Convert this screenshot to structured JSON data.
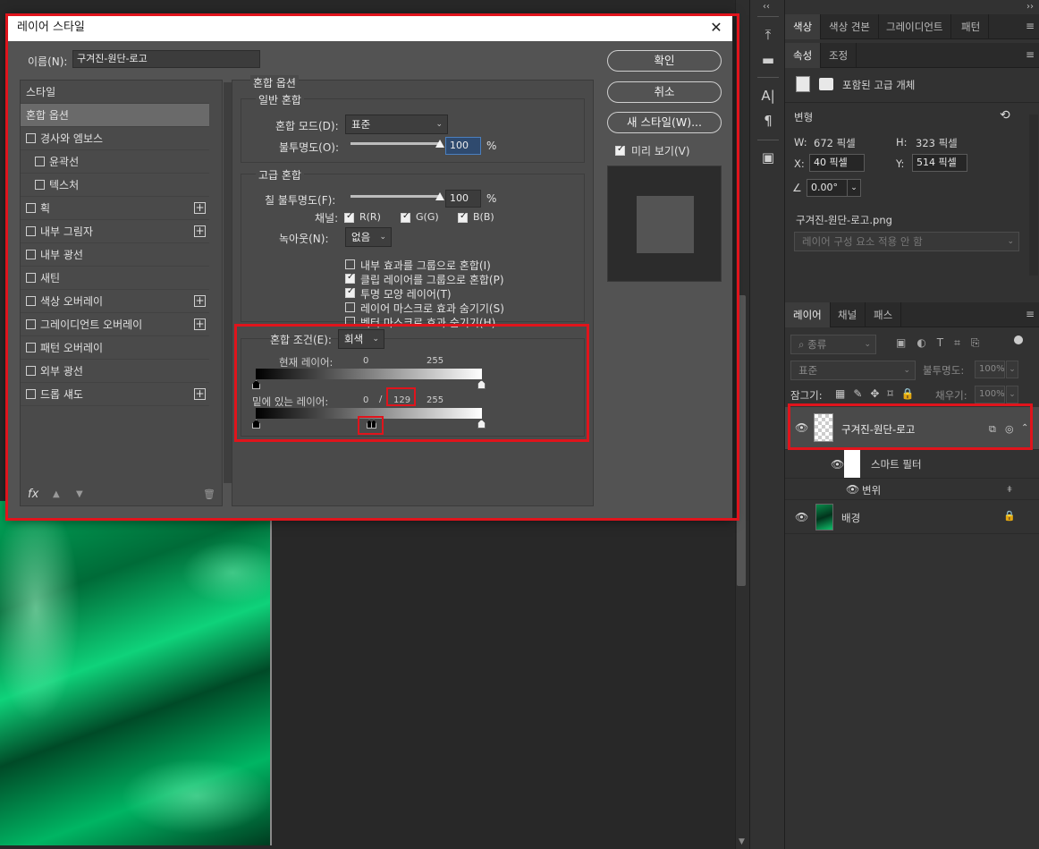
{
  "dialog": {
    "title": "레이어 스타일",
    "close_icon": "✕",
    "name_label": "이름(N):",
    "name_value": "구겨진-원단-로고",
    "buttons": {
      "ok": "확인",
      "cancel": "취소",
      "new_style": "새 스타일(W)...",
      "preview": "미리 보기(V)"
    },
    "styles": [
      {
        "label": "스타일",
        "checkbox": false,
        "plus": false,
        "active": false
      },
      {
        "label": "혼합 옵션",
        "checkbox": false,
        "plus": false,
        "active": true
      },
      {
        "label": "경사와 엠보스",
        "checkbox": true,
        "plus": false
      },
      {
        "label": "윤곽선",
        "checkbox": true,
        "plus": false,
        "indent": true
      },
      {
        "label": "텍스처",
        "checkbox": true,
        "plus": false,
        "indent": true
      },
      {
        "label": "획",
        "checkbox": true,
        "plus": true
      },
      {
        "label": "내부 그림자",
        "checkbox": true,
        "plus": true
      },
      {
        "label": "내부 광선",
        "checkbox": true,
        "plus": false
      },
      {
        "label": "새틴",
        "checkbox": true,
        "plus": false
      },
      {
        "label": "색상 오버레이",
        "checkbox": true,
        "plus": true
      },
      {
        "label": "그레이디언트 오버레이",
        "checkbox": true,
        "plus": true
      },
      {
        "label": "패턴 오버레이",
        "checkbox": true,
        "plus": false
      },
      {
        "label": "외부 광선",
        "checkbox": true,
        "plus": false
      },
      {
        "label": "드롭 섀도",
        "checkbox": true,
        "plus": true
      }
    ],
    "fx_icons": {
      "fx": "fx",
      "up": "▲",
      "down": "▼",
      "trash": "🗑"
    },
    "blend_options": {
      "title": "혼합 옵션",
      "general": {
        "title": "일반 혼합",
        "mode_label": "혼합 모드(D):",
        "mode_value": "표준",
        "opacity_label": "불투명도(O):",
        "opacity_value": "100",
        "opacity_level": 100,
        "unit": "%"
      },
      "advanced": {
        "title": "고급 혼합",
        "fill_label": "칠 불투명도(F):",
        "fill_value": "100",
        "fill_level": 100,
        "unit": "%",
        "channels_label": "채널:",
        "ch_r": "R(R)",
        "ch_g": "G(G)",
        "ch_b": "B(B)",
        "knockout_label": "녹아웃(N):",
        "knockout_value": "없음",
        "options": [
          {
            "label": "내부 효과를 그룹으로 혼합(I)",
            "checked": false
          },
          {
            "label": "클립 레이어를 그룹으로 혼합(P)",
            "checked": true
          },
          {
            "label": "투명 모양 레이어(T)",
            "checked": true
          },
          {
            "label": "레이어 마스크로 효과 숨기기(S)",
            "checked": false
          },
          {
            "label": "벡터 마스크로 효과 숨기기(H)",
            "checked": false
          }
        ]
      },
      "blend_if": {
        "label": "혼합 조건(E):",
        "value": "회색",
        "this_layer_label": "현재 레이어:",
        "this_low": "0",
        "this_high": "255",
        "under_layer_label": "밑에 있는 레이어:",
        "under_low": "0",
        "under_sep": "/",
        "under_split": "129",
        "under_high": "255"
      }
    }
  },
  "toolstrip": {
    "icons": [
      "history-icon",
      "comment-icon",
      "character-icon",
      "paragraph-icon",
      "libraries-icon"
    ],
    "glyphs": [
      "⤒",
      "▬",
      "A|",
      "¶",
      "▣"
    ],
    "collapse": "‹‹"
  },
  "panels": {
    "expand": "››",
    "top_tabs": [
      "색상",
      "색상 견본",
      "그레이디언트",
      "패턴"
    ],
    "prop_tabs": [
      "속성",
      "조정"
    ],
    "smart_object_label": "포함된 고급 개체",
    "transform_label": "변형",
    "w_label": "W:",
    "w_value": "672 픽셀",
    "h_label": "H:",
    "h_value": "323 픽셀",
    "x_label": "X:",
    "x_value": "40 픽셀",
    "y_label": "Y:",
    "y_value": "514 픽셀",
    "angle_value": "0.00°",
    "file_name": "구겨진-원단-로고.png",
    "layer_comp_value": "레이어 구성 요소 적용 안 함",
    "layers_tabs": [
      "레이어",
      "채널",
      "패스"
    ],
    "filter_placeholder": "종류",
    "blend_mode": "표준",
    "opacity_label": "불투명도:",
    "opacity_value": "100%",
    "lock_label": "잠그기:",
    "fill_label": "채우기:",
    "fill_value": "100%",
    "layers": [
      {
        "name": "구겨진-원단-로고",
        "selected": true
      },
      {
        "name": "스마트 필터"
      },
      {
        "name": "변위"
      },
      {
        "name": "배경"
      }
    ]
  }
}
